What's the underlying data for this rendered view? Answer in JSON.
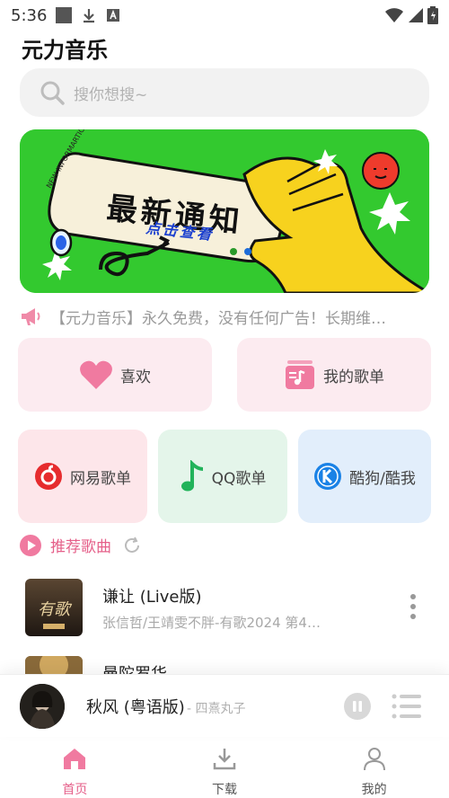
{
  "status": {
    "time": "5:36"
  },
  "app": {
    "title": "元力音乐"
  },
  "search": {
    "placeholder": "搜你想搜~"
  },
  "banner": {
    "title": "最新通知",
    "subtitle": "点击查看",
    "arc_text": "NEW INFORMARTION",
    "dots": 2,
    "active_dot": 1
  },
  "notice": {
    "text": "【元力音乐】永久免费，没有任何广告！长期维…"
  },
  "quick": {
    "like": "喜欢",
    "my_playlist": "我的歌单"
  },
  "sources": [
    {
      "label": "网易歌单",
      "icon": "netease-icon"
    },
    {
      "label": "QQ歌单",
      "icon": "qq-music-icon"
    },
    {
      "label": "酷狗/酷我",
      "icon": "kugou-icon"
    }
  ],
  "recommend": {
    "title": "推荐歌曲"
  },
  "songs": [
    {
      "title": "谦让 (Live版)",
      "subtitle": "张信哲/王靖雯不胖-有歌2024 第4…",
      "cover_text": "有歌"
    },
    {
      "title": "曼陀罗华",
      "subtitle": ""
    }
  ],
  "player": {
    "title": "秋风 (粤语版)",
    "artist": "- 四熹丸子"
  },
  "nav": [
    {
      "label": "首页",
      "active": true
    },
    {
      "label": "下载",
      "active": false
    },
    {
      "label": "我的",
      "active": false
    }
  ],
  "colors": {
    "accent": "#e5608a",
    "banner_bg": "#33c92f"
  }
}
